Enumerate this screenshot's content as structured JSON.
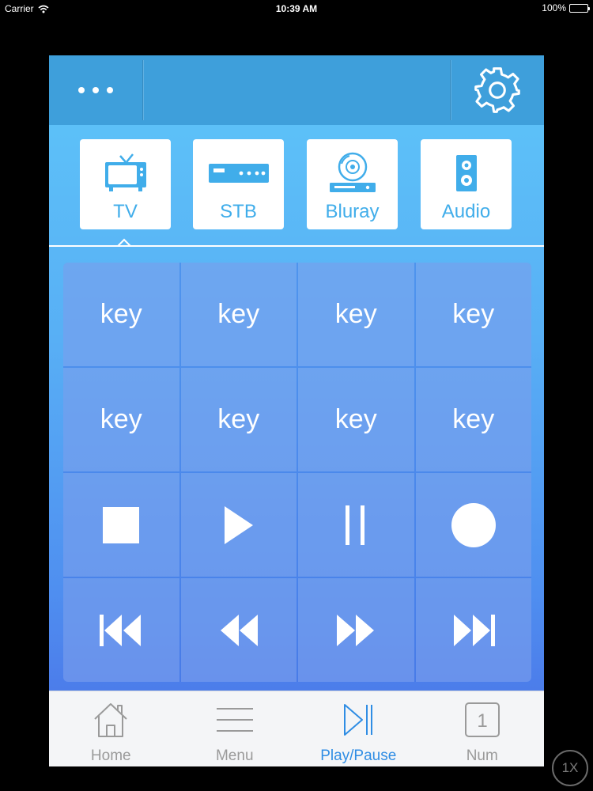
{
  "status_bar": {
    "carrier": "Carrier",
    "time": "10:39 AM",
    "battery": "100%"
  },
  "colors": {
    "accent": "#40adea",
    "header": "#3e9fdb",
    "tab_active": "#2f8de4",
    "tab_inactive": "#9a9a9a"
  },
  "header": {
    "menu_icon": "more-dots-icon",
    "settings_icon": "gear-icon"
  },
  "devices": [
    {
      "label": "TV",
      "icon": "tv-icon",
      "selected": true
    },
    {
      "label": "STB",
      "icon": "set-top-box-icon",
      "selected": false
    },
    {
      "label": "Bluray",
      "icon": "bluray-player-icon",
      "selected": false
    },
    {
      "label": "Audio",
      "icon": "speaker-icon",
      "selected": false
    }
  ],
  "keys": {
    "row1": [
      "key",
      "key",
      "key",
      "key"
    ],
    "row2": [
      "key",
      "key",
      "key",
      "key"
    ],
    "transport": [
      "stop-icon",
      "play-icon",
      "pause-icon",
      "record-icon"
    ],
    "seek": [
      "skip-previous-icon",
      "rewind-icon",
      "fast-forward-icon",
      "skip-next-icon"
    ]
  },
  "tabbar": {
    "tabs": [
      {
        "label": "Home",
        "icon": "home-icon",
        "active": false
      },
      {
        "label": "Menu",
        "icon": "menu-lines-icon",
        "active": false
      },
      {
        "label": "Play/Pause",
        "icon": "play-pause-icon",
        "active": true
      },
      {
        "label": "Num",
        "icon": "number-pad-icon",
        "active": false
      }
    ],
    "num_icon_text": "1"
  },
  "zoom_badge": "1X"
}
